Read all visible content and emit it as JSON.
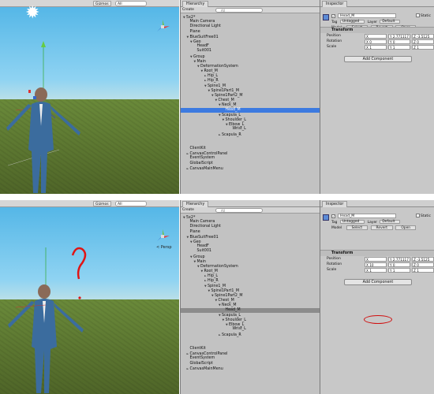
{
  "top": {
    "scene": {
      "gizmos_label": "Gizmos",
      "search": "All"
    },
    "hierarchy": {
      "tab": "Hierarchy",
      "create": "Create",
      "search": "All",
      "rows": [
        {
          "label": "5x2*",
          "indent": 0,
          "arrow": "▼"
        },
        {
          "label": "Main Camera",
          "indent": 1,
          "arrow": ""
        },
        {
          "label": "Directional Light",
          "indent": 1,
          "arrow": ""
        },
        {
          "label": "Plane",
          "indent": 1,
          "arrow": ""
        },
        {
          "label": "BlueSuitFree01",
          "indent": 1,
          "arrow": "▼"
        },
        {
          "label": "Geo",
          "indent": 2,
          "arrow": "▼"
        },
        {
          "label": "HeadF",
          "indent": 3,
          "arrow": ""
        },
        {
          "label": "Suit001",
          "indent": 3,
          "arrow": ""
        },
        {
          "label": "Group",
          "indent": 2,
          "arrow": "▼"
        },
        {
          "label": "Main",
          "indent": 3,
          "arrow": "▼"
        },
        {
          "label": "DeformationSystem",
          "indent": 4,
          "arrow": "▼"
        },
        {
          "label": "Root_M",
          "indent": 5,
          "arrow": "▼"
        },
        {
          "label": "Hip_L",
          "indent": 6,
          "arrow": "►"
        },
        {
          "label": "Hip_R",
          "indent": 6,
          "arrow": "►"
        },
        {
          "label": "Spine1_M",
          "indent": 6,
          "arrow": "▼"
        },
        {
          "label": "Spine1Part1_M",
          "indent": 7,
          "arrow": "▼"
        },
        {
          "label": "Spine1Part2_M",
          "indent": 8,
          "arrow": "▼"
        },
        {
          "label": "Chest_M",
          "indent": 9,
          "arrow": "▼"
        },
        {
          "label": "Neck_M",
          "indent": 10,
          "arrow": "▼"
        },
        {
          "label": "Head_M",
          "indent": 11,
          "arrow": "",
          "selected": true
        },
        {
          "label": "Scapula_L",
          "indent": 10,
          "arrow": "▼"
        },
        {
          "label": "Shoulder_L",
          "indent": 11,
          "arrow": "▼"
        },
        {
          "label": "Elbow_L",
          "indent": 12,
          "arrow": "▼"
        },
        {
          "label": "Wrist_L",
          "indent": 13,
          "arrow": ""
        },
        {
          "label": "Scapula_R",
          "indent": 10,
          "arrow": "►"
        },
        {
          "label": "",
          "indent": 0,
          "arrow": ""
        },
        {
          "label": "",
          "indent": 0,
          "arrow": ""
        },
        {
          "label": "ClientKit",
          "indent": 1,
          "arrow": ""
        },
        {
          "label": "CanvasControlPanel",
          "indent": 1,
          "arrow": "►"
        },
        {
          "label": "EventSystem",
          "indent": 1,
          "arrow": ""
        },
        {
          "label": "GlobalScript",
          "indent": 1,
          "arrow": ""
        },
        {
          "label": "CanvasMainMenu",
          "indent": 1,
          "arrow": "►"
        }
      ]
    },
    "inspector": {
      "tab": "Inspector",
      "name": "Head_M",
      "static": "Static",
      "tag_label": "Tag",
      "tag_value": "Untagged",
      "layer_label": "Layer",
      "layer_value": "Default",
      "model_label": "Model",
      "select": "Select",
      "revert": "Revert",
      "open": "Open",
      "transform": "Transform",
      "position_label": "Position",
      "rotation_label": "Rotation",
      "scale_label": "Scale",
      "position": [
        "X -0.0992239",
        "Y 2.771117",
        "Z -3.5125"
      ],
      "rotation": [
        "X 0",
        "Y 0",
        "Z 0"
      ],
      "scale": [
        "X 1",
        "Y 1",
        "Z 1"
      ],
      "add_component": "Add Component"
    }
  },
  "bottom": {
    "scene": {
      "gizmos_label": "Gizmos",
      "search": "All",
      "persp": "< Persp"
    },
    "hierarchy": {
      "tab": "Hierarchy",
      "create": "Create",
      "search": "All",
      "rows": [
        {
          "label": "5x2*",
          "indent": 0,
          "arrow": "▼"
        },
        {
          "label": "Main Camera",
          "indent": 1,
          "arrow": ""
        },
        {
          "label": "Directional Light",
          "indent": 1,
          "arrow": ""
        },
        {
          "label": "Plane",
          "indent": 1,
          "arrow": ""
        },
        {
          "label": "BlueSuitFree01",
          "indent": 1,
          "arrow": "▼"
        },
        {
          "label": "Geo",
          "indent": 2,
          "arrow": "▼"
        },
        {
          "label": "HeadF",
          "indent": 3,
          "arrow": ""
        },
        {
          "label": "Suit001",
          "indent": 3,
          "arrow": ""
        },
        {
          "label": "Group",
          "indent": 2,
          "arrow": "▼"
        },
        {
          "label": "Main",
          "indent": 3,
          "arrow": "▼"
        },
        {
          "label": "DeformationSystem",
          "indent": 4,
          "arrow": "▼"
        },
        {
          "label": "Root_M",
          "indent": 5,
          "arrow": "▼"
        },
        {
          "label": "Hip_L",
          "indent": 6,
          "arrow": "►"
        },
        {
          "label": "Hip_R",
          "indent": 6,
          "arrow": "►"
        },
        {
          "label": "Spine1_M",
          "indent": 6,
          "arrow": "▼"
        },
        {
          "label": "Spine1Part1_M",
          "indent": 7,
          "arrow": "▼"
        },
        {
          "label": "Spine1Part2_M",
          "indent": 8,
          "arrow": "▼"
        },
        {
          "label": "Chest_M",
          "indent": 9,
          "arrow": "▼"
        },
        {
          "label": "Neck_M",
          "indent": 10,
          "arrow": "▼"
        },
        {
          "label": "Head_M",
          "indent": 11,
          "arrow": "",
          "selected": true
        },
        {
          "label": "Scapula_L",
          "indent": 10,
          "arrow": "▼"
        },
        {
          "label": "Shoulder_L",
          "indent": 11,
          "arrow": "▼"
        },
        {
          "label": "Elbow_L",
          "indent": 12,
          "arrow": "▼"
        },
        {
          "label": "Wrist_L",
          "indent": 13,
          "arrow": ""
        },
        {
          "label": "Scapula_R",
          "indent": 10,
          "arrow": "►"
        },
        {
          "label": "",
          "indent": 0,
          "arrow": ""
        },
        {
          "label": "",
          "indent": 0,
          "arrow": ""
        },
        {
          "label": "ClientKit",
          "indent": 1,
          "arrow": ""
        },
        {
          "label": "CanvasControlPanel",
          "indent": 1,
          "arrow": "►"
        },
        {
          "label": "EventSystem",
          "indent": 1,
          "arrow": ""
        },
        {
          "label": "GlobalScript",
          "indent": 1,
          "arrow": ""
        },
        {
          "label": "CanvasMainMenu",
          "indent": 1,
          "arrow": "►"
        }
      ]
    },
    "inspector": {
      "tab": "Inspector",
      "name": "Head_M",
      "static": "Static",
      "tag_label": "Tag",
      "tag_value": "Untagged",
      "layer_label": "Layer",
      "layer_value": "Default",
      "model_label": "Model",
      "select": "Select",
      "revert": "Revert",
      "open": "Open",
      "transform": "Transform",
      "position_label": "Position",
      "rotation_label": "Rotation",
      "scale_label": "Scale",
      "position": [
        "X -0.0992239",
        "Y 2.771117",
        "Z -3.5125"
      ],
      "rotation": [
        "X 10",
        "Y 0",
        "Z 0"
      ],
      "scale": [
        "X 1",
        "Y 1",
        "Z 1"
      ],
      "add_component": "Add Component"
    }
  },
  "colors": {
    "selection_blue": "#3c7ae0",
    "annotation_red": "#d01010"
  }
}
